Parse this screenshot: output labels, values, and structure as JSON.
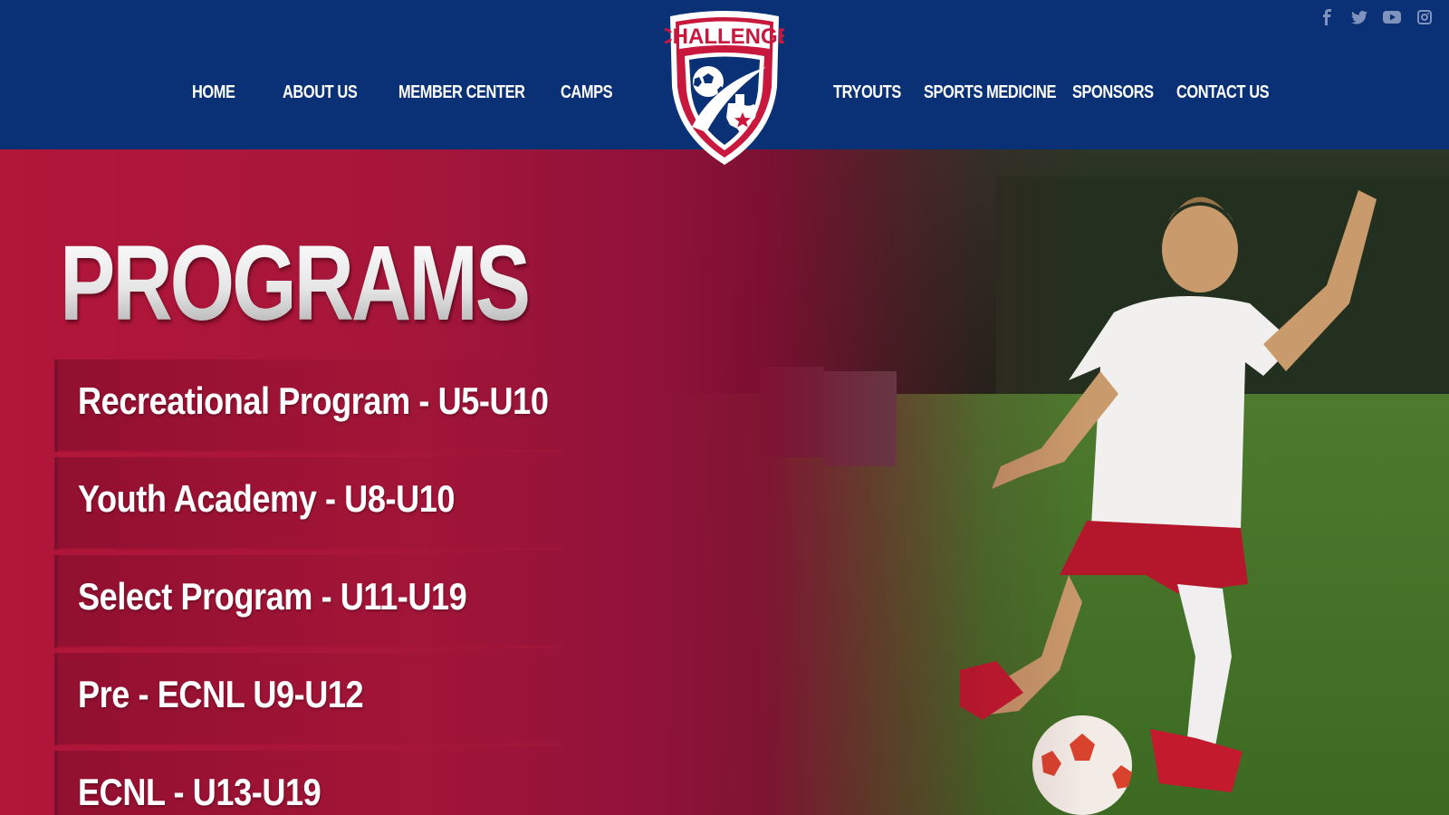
{
  "nav": {
    "left": [
      {
        "label": "HOME"
      },
      {
        "label": "ABOUT US"
      },
      {
        "label": "MEMBER CENTER"
      },
      {
        "label": "CAMPS"
      }
    ],
    "right": [
      {
        "label": "TRYOUTS"
      },
      {
        "label": "SPORTS MEDICINE"
      },
      {
        "label": "SPONSORS"
      },
      {
        "label": "CONTACT US"
      }
    ]
  },
  "logo": {
    "wordmark": "CHALLENGE"
  },
  "social": {
    "icons": [
      "facebook-icon",
      "twitter-icon",
      "youtube-icon",
      "instagram-icon"
    ]
  },
  "hero": {
    "title": "PROGRAMS",
    "programs": [
      {
        "label": "Recreational Program - U5-U10"
      },
      {
        "label": "Youth Academy - U8-U10"
      },
      {
        "label": "Select Program - U11-U19"
      },
      {
        "label": "Pre - ECNL U9-U12"
      },
      {
        "label": "ECNL - U13-U19"
      }
    ]
  },
  "colors": {
    "navy": "#0a3176",
    "crimson": "#b21639",
    "white": "#ffffff"
  }
}
